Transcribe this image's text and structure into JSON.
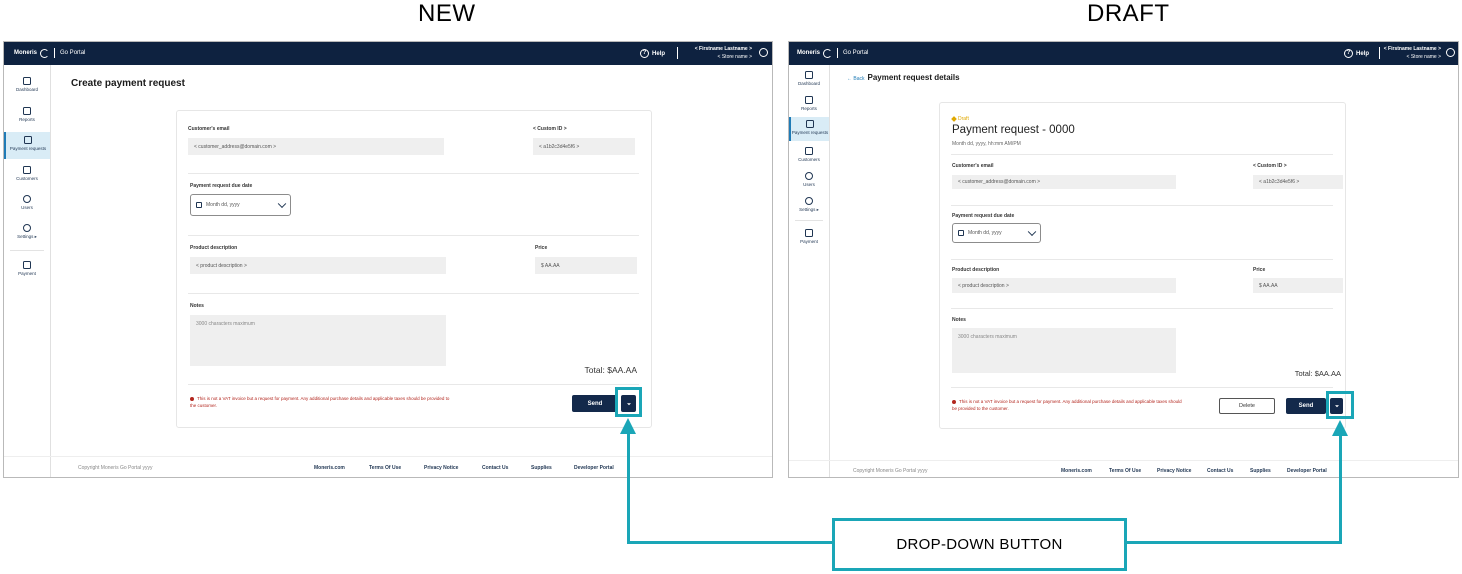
{
  "headings": {
    "new": "NEW",
    "draft": "DRAFT"
  },
  "brand": {
    "logo": "Moneris",
    "product": "Go Portal"
  },
  "topbar": {
    "help": "Help",
    "user_name": "< Firstname Lastname >",
    "store_name": "< Store name >"
  },
  "sidebar": {
    "items": [
      {
        "label": "Dashboard",
        "icon": "dashboard-icon"
      },
      {
        "label": "Reports",
        "icon": "reports-icon"
      },
      {
        "label": "Payment requests",
        "icon": "payment-requests-icon"
      },
      {
        "label": "Customers",
        "icon": "customers-icon"
      },
      {
        "label": "Users",
        "icon": "users-icon"
      },
      {
        "label": "Settings ▸",
        "icon": "settings-icon"
      },
      {
        "label": "Payment",
        "icon": "payment-icon"
      }
    ]
  },
  "new_screen": {
    "page_title": "Create payment request",
    "customer_email_label": "Customer's email",
    "customer_email_value": "< customer_address@domain.com >",
    "custom_id_label": "< Custom ID >",
    "custom_id_value": "< a1b2c3d4e5f6 >",
    "due_date_label": "Payment request due date",
    "due_date_value": "Month dd, yyyy",
    "product_label": "Product description",
    "product_value": "< product description >",
    "price_label": "Price",
    "price_value": "$ AA.AA",
    "notes_label": "Notes",
    "notes_placeholder": "3000 characters maximum",
    "total_label": "Total:",
    "total_value": "$AA.AA",
    "warning": "This is not a VAT invoice but a request for payment. Any additional purchase details and applicable taxes should be provided to the customer.",
    "send": "Send"
  },
  "draft_screen": {
    "back": "← Back",
    "page_title": "Payment request details",
    "status": "Draft",
    "request_title": "Payment request - 0000",
    "request_datetime": "Month dd, yyyy, hh:mm AM/PM",
    "customer_email_label": "Customer's email",
    "customer_email_value": "< customer_address@domain.com >",
    "custom_id_label": "< Custom ID >",
    "custom_id_value": "< a1b2c3d4e5f6 >",
    "due_date_label": "Payment request due date",
    "due_date_value": "Month dd, yyyy",
    "product_label": "Product description",
    "product_value": "< product description >",
    "price_label": "Price",
    "price_value": "$ AA.AA",
    "notes_label": "Notes",
    "notes_placeholder": "3000 characters maximum",
    "total_label": "Total:",
    "total_value": "$AA.AA",
    "warning": "This is not a VAT invoice but a request for payment. Any additional purchase details and applicable taxes should be provided to the customer.",
    "delete": "Delete",
    "send": "Send"
  },
  "footer": {
    "copyright": "Copyright Moneris Go Portal yyyy",
    "links": [
      "Moneris.com",
      "Terms Of Use",
      "Privacy Notice",
      "Contact Us",
      "Supplies",
      "Developer Portal"
    ]
  },
  "callout": {
    "label": "DROP-DOWN BUTTON"
  },
  "colors": {
    "navy": "#0e2240",
    "accent": "#1aa6b7",
    "warning": "#b3261e",
    "draft": "#e0a800"
  }
}
